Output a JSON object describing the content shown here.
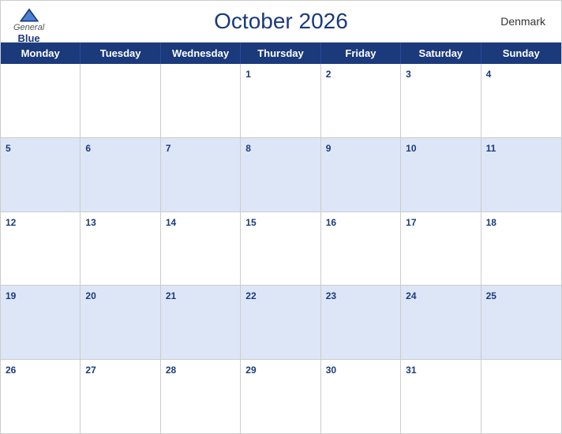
{
  "header": {
    "title": "October 2026",
    "country": "Denmark",
    "logo": {
      "general": "General",
      "blue": "Blue"
    }
  },
  "days_of_week": [
    "Monday",
    "Tuesday",
    "Wednesday",
    "Thursday",
    "Friday",
    "Saturday",
    "Sunday"
  ],
  "weeks": [
    [
      {
        "num": "",
        "empty": true
      },
      {
        "num": "",
        "empty": true
      },
      {
        "num": "",
        "empty": true
      },
      {
        "num": "1"
      },
      {
        "num": "2"
      },
      {
        "num": "3"
      },
      {
        "num": "4"
      }
    ],
    [
      {
        "num": "5"
      },
      {
        "num": "6"
      },
      {
        "num": "7"
      },
      {
        "num": "8"
      },
      {
        "num": "9"
      },
      {
        "num": "10"
      },
      {
        "num": "11"
      }
    ],
    [
      {
        "num": "12"
      },
      {
        "num": "13"
      },
      {
        "num": "14"
      },
      {
        "num": "15"
      },
      {
        "num": "16"
      },
      {
        "num": "17"
      },
      {
        "num": "18"
      }
    ],
    [
      {
        "num": "19"
      },
      {
        "num": "20"
      },
      {
        "num": "21"
      },
      {
        "num": "22"
      },
      {
        "num": "23"
      },
      {
        "num": "24"
      },
      {
        "num": "25"
      }
    ],
    [
      {
        "num": "26"
      },
      {
        "num": "27"
      },
      {
        "num": "28"
      },
      {
        "num": "29"
      },
      {
        "num": "30"
      },
      {
        "num": "31"
      },
      {
        "num": "",
        "empty": true
      }
    ]
  ],
  "colors": {
    "header_bg": "#1a3a7c",
    "alt_row_bg": "#dce6f7",
    "white_bg": "#ffffff",
    "title_color": "#1a3a7c"
  }
}
